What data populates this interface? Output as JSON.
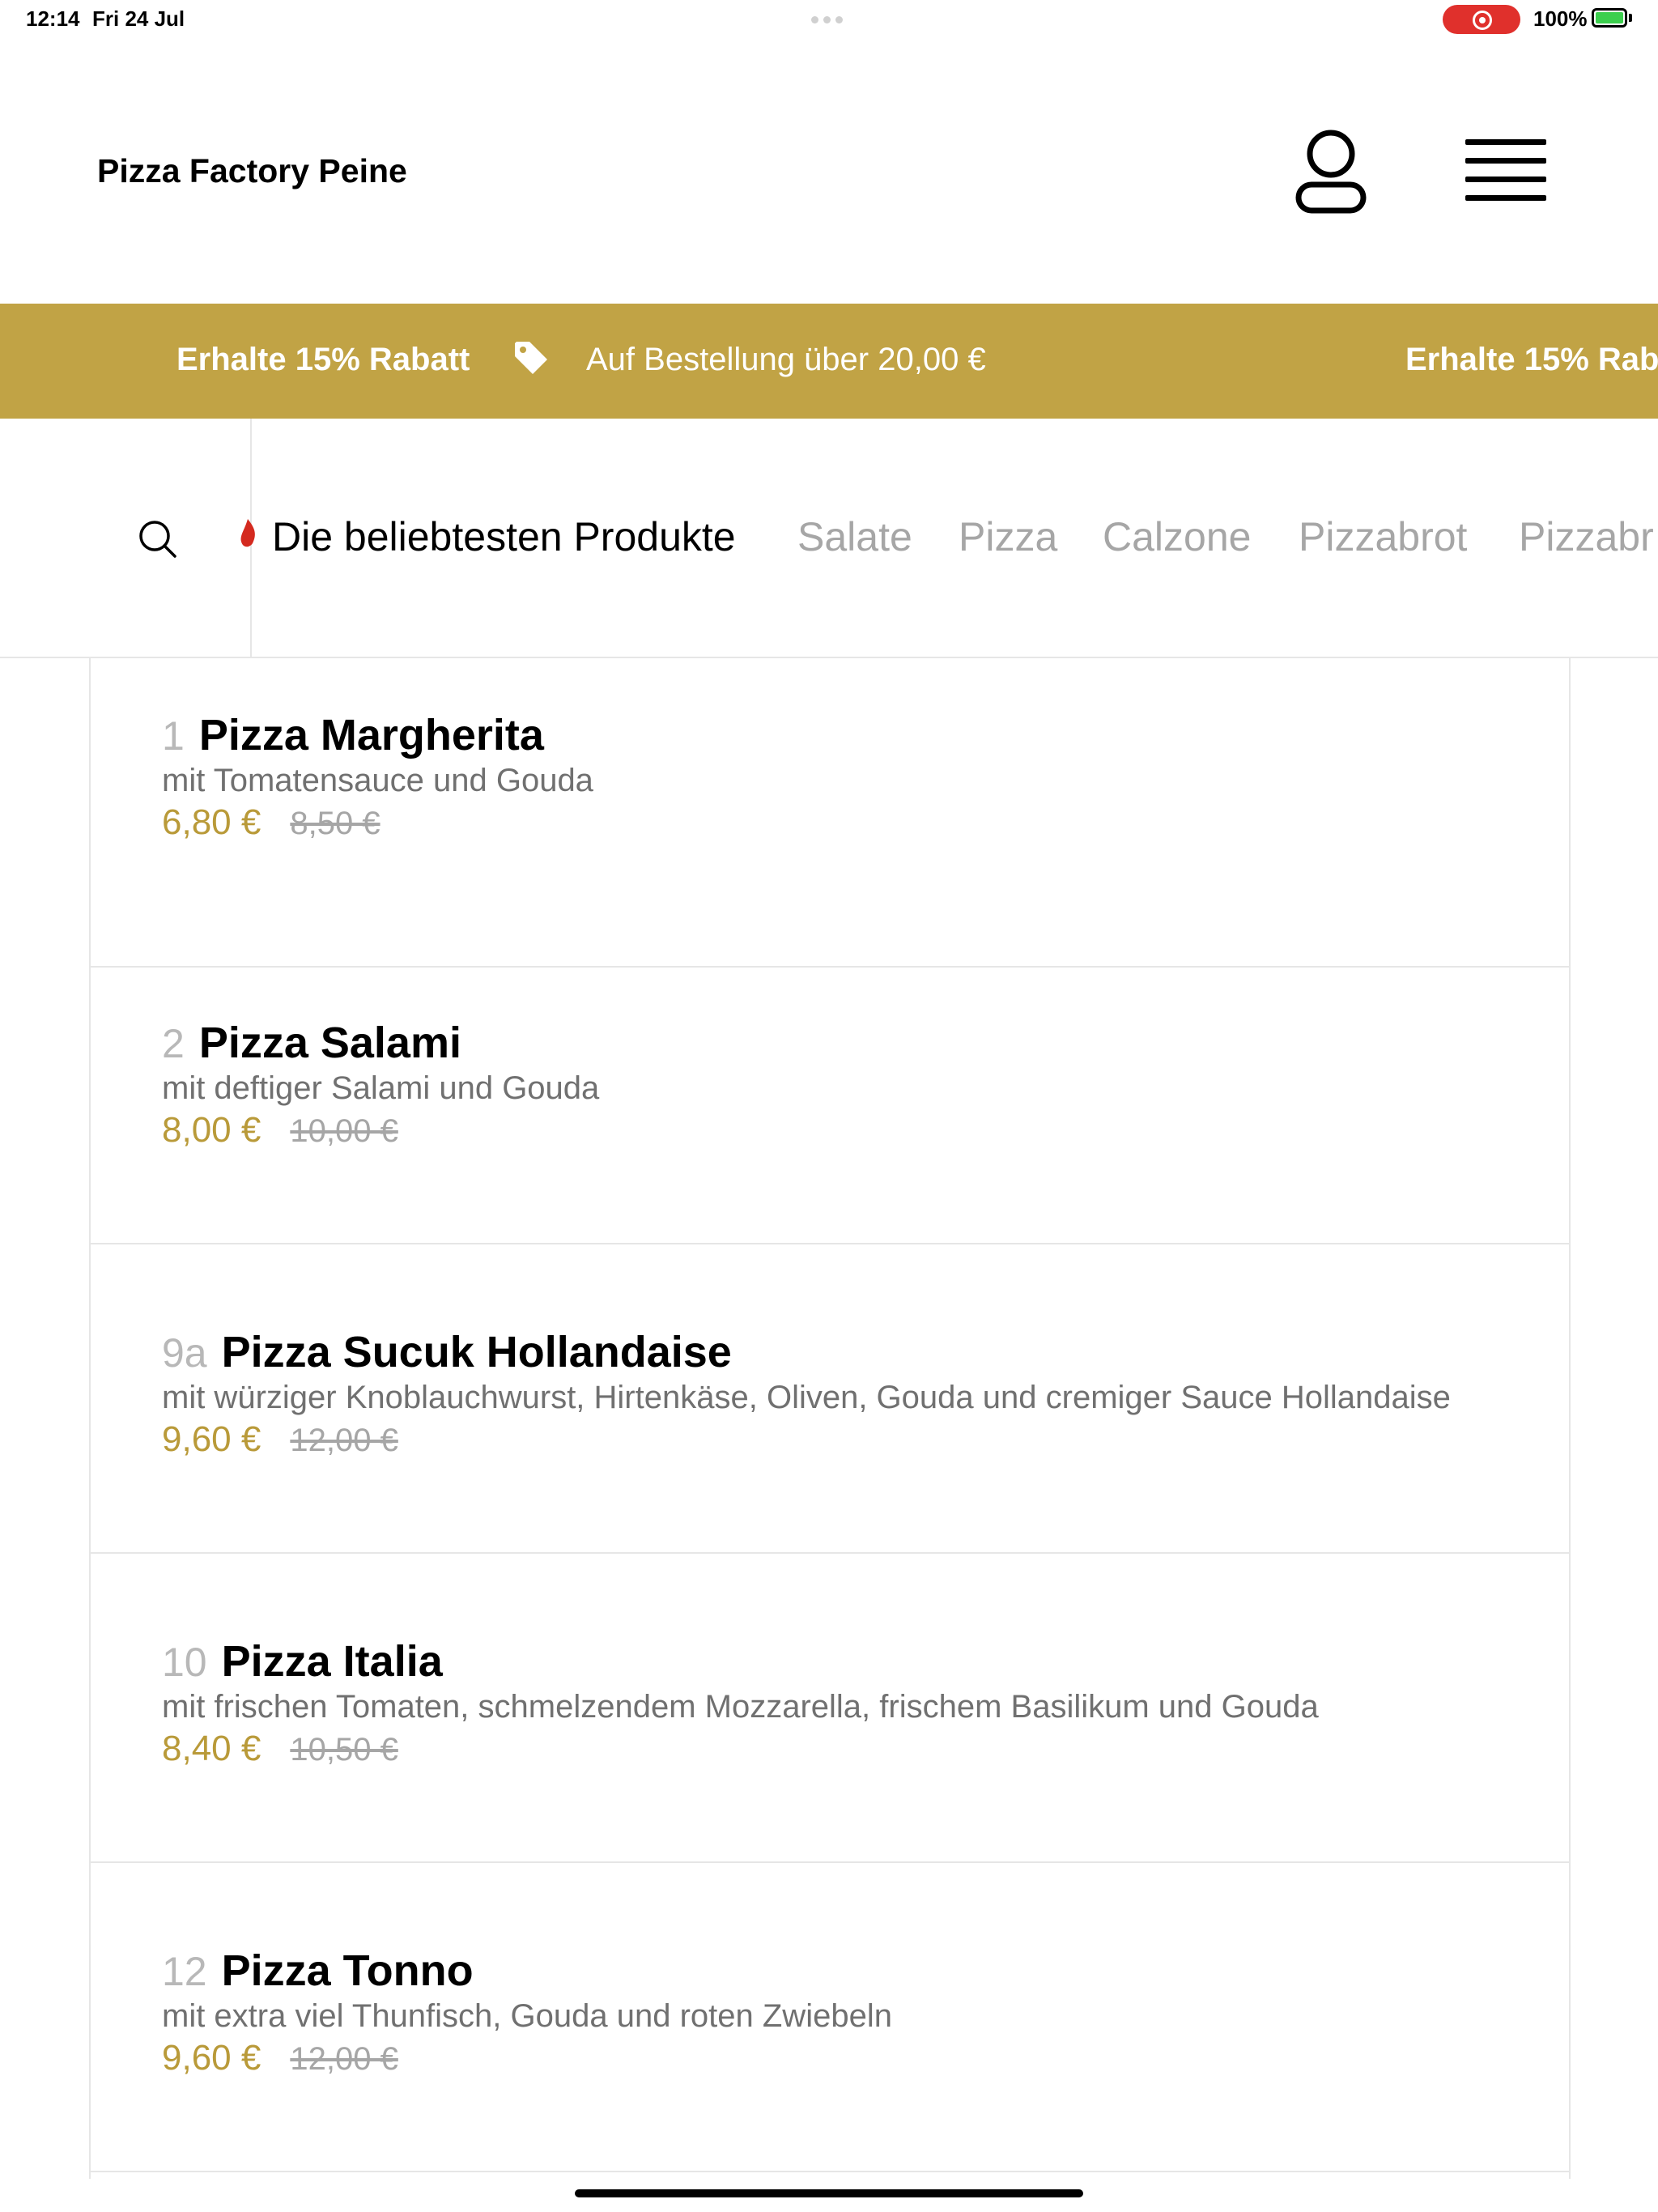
{
  "status_bar": {
    "time": "12:14",
    "date": "Fri 24 Jul",
    "battery": "100%"
  },
  "header": {
    "brand": "Pizza Factory Peine",
    "user_icon": "user-icon",
    "menu_icon": "hamburger-menu-icon"
  },
  "promo": {
    "title": "Erhalte 15% Rabatt",
    "tag_icon": "tag-icon",
    "text": "Auf Bestellung über 20,00 €",
    "title_repeat": "Erhalte 15% Rab",
    "background": "#c1a345"
  },
  "categories": {
    "search_icon": "search-icon",
    "items": [
      {
        "label": "Die beliebtesten Produkte",
        "active": true
      },
      {
        "label": "Salate",
        "active": false
      },
      {
        "label": "Pizza",
        "active": false
      },
      {
        "label": "Calzone",
        "active": false
      },
      {
        "label": "Pizzabrot",
        "active": false
      },
      {
        "label": "Pizzabr",
        "active": false
      }
    ]
  },
  "products": [
    {
      "number": "1",
      "name": "Pizza Margherita",
      "description": "mit Tomatensauce und Gouda",
      "price": "6,80 €",
      "old_price": "8,50 €"
    },
    {
      "number": "2",
      "name": "Pizza Salami",
      "description": "mit deftiger Salami und Gouda",
      "price": "8,00 €",
      "old_price": "10,00 €"
    },
    {
      "number": "9a",
      "name": "Pizza Sucuk Hollandaise",
      "description": "mit würziger Knoblauchwurst, Hirtenkäse, Oliven, Gouda und cremiger Sauce Hollandaise",
      "price": "9,60 €",
      "old_price": "12,00 €"
    },
    {
      "number": "10",
      "name": "Pizza Italia",
      "description": "mit frischen Tomaten, schmelzendem Mozzarella, frischem Basilikum und Gouda",
      "price": "8,40 €",
      "old_price": "10,50 €"
    },
    {
      "number": "12",
      "name": "Pizza Tonno",
      "description": "mit extra viel Thunfisch, Gouda und roten Zwiebeln",
      "price": "9,60 €",
      "old_price": "12,00 €"
    }
  ],
  "colors": {
    "accent": "#c1a345",
    "price": "#b99a39",
    "muted": "#a6a6a6"
  }
}
